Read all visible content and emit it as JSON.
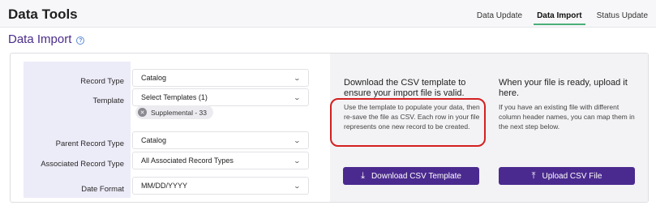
{
  "header": {
    "title": "Data Tools",
    "tabs": [
      {
        "label": "Data Update",
        "active": false
      },
      {
        "label": "Data Import",
        "active": true
      },
      {
        "label": "Status Update",
        "active": false
      }
    ]
  },
  "page": {
    "title": "Data Import"
  },
  "form": {
    "record_type": {
      "label": "Record Type",
      "value": "Catalog"
    },
    "template": {
      "label": "Template",
      "value": "Select Templates (1)",
      "chip": "Supplemental - 33"
    },
    "parent_record_type": {
      "label": "Parent Record Type",
      "value": "Catalog"
    },
    "associated_record_type": {
      "label": "Associated Record Type",
      "value": "All Associated Record Types"
    },
    "date_format": {
      "label": "Date Format",
      "value": "MM/DD/YYYY"
    }
  },
  "download": {
    "heading": "Download the CSV template to ensure your import file is valid.",
    "body": "Use the template to populate your data, then re-save the file as CSV. Each row in your file represents one new record to be created.",
    "button": "Download CSV Template"
  },
  "upload": {
    "heading": "When your file is ready, upload it here.",
    "body": "If you have an existing file with different column header names, you can map them in the next step below.",
    "button": "Upload CSV File"
  },
  "colors": {
    "accent": "#4b2a8f",
    "highlight": "#d42020",
    "tab_underline": "#4caf78"
  }
}
